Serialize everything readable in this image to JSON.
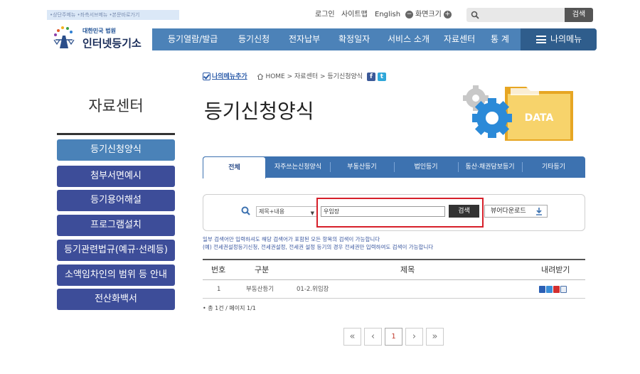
{
  "skip_links": "•상단주메뉴 •좌측서브메뉴 •본문바로가기",
  "utility": {
    "login": "로그인",
    "sitemap": "사이트맵",
    "english": "English",
    "zoom_out": "화면크기",
    "minus": "−",
    "plus": "+",
    "search_button": "검색",
    "search_value": ""
  },
  "logo": {
    "small": "대한민국 법원",
    "big": "인터넷등기소"
  },
  "nav": {
    "items": [
      "등기열람/발급",
      "등기신청",
      "전자납부",
      "확정일자",
      "서비스 소개",
      "자료센터",
      "통 계"
    ],
    "my_menu": "나의메뉴"
  },
  "sidebar": {
    "title": "자료센터",
    "items": [
      {
        "label": "등기신청양식"
      },
      {
        "label": "첨부서면예시"
      },
      {
        "label": "등기용어해설"
      },
      {
        "label": "프로그램설치"
      },
      {
        "label": "등기관련법규(예규·선례등)"
      },
      {
        "label": "소액임차인의 범위 등 안내"
      },
      {
        "label": "전산화백서"
      }
    ]
  },
  "breadcrumb": {
    "add_my_menu": "나의메뉴추가",
    "path": "HOME > 자료센터 > 등기신청양식",
    "fb": "f",
    "tw": "t"
  },
  "page_title": "등기신청양식",
  "illustration_text": "DATA",
  "tabs": [
    "전체",
    "자주쓰는신청양식",
    "부동산등기",
    "법인등기",
    "동산·채권담보등기",
    "기타등기"
  ],
  "search": {
    "select": "제목+내용",
    "select_arrow": "▼",
    "input_value": "우임장",
    "button": "검색",
    "viewer_download": "뷰어다운로드"
  },
  "notes": [
    "일부 검색어만 입력하셔도 해당 검색어가 포함된 모든 항목의 검색이 가능합니다",
    "(예) 전세권설정등기신청, 전세권설정, 전세권 설정 등기의 경우 전세권만 입력하여도 검색이 가능합니다"
  ],
  "table": {
    "headers": [
      "번호",
      "구분",
      "제목",
      "내려받기"
    ],
    "rows": [
      {
        "no": "1",
        "category": "부동산등기",
        "title": "01-2.위임장"
      }
    ]
  },
  "total": "• 총 1건 / 페이지 1/1",
  "pager": {
    "first": "«",
    "prev": "‹",
    "current": "1",
    "next": "›",
    "last": "»"
  },
  "colors": {
    "nav": "#4c82b8",
    "sidebar": "#3d4d99",
    "sidebar_active": "#4a82b8",
    "highlight": "#d6202a"
  }
}
